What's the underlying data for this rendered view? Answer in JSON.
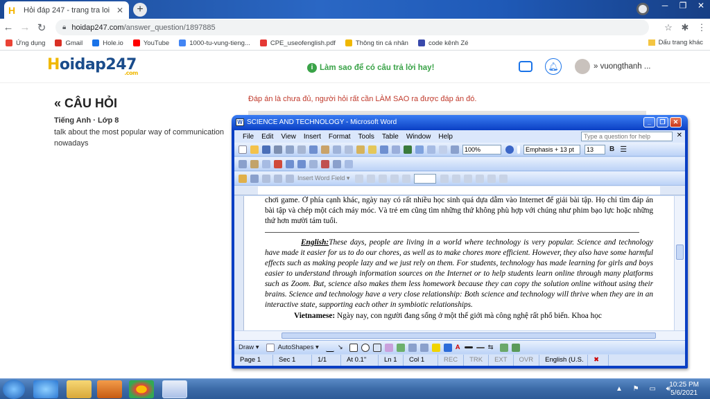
{
  "browser": {
    "tab_title": "Hỏi đáp 247 - trang tra loi",
    "tab_close": "✕",
    "new_tab": "+",
    "url_host": "hoidap247.com",
    "url_path": "/answer_question/1897885",
    "bookmarks": [
      {
        "label": "Ứng dụng",
        "color": "#ea4335"
      },
      {
        "label": "Gmail",
        "color": "#d93025"
      },
      {
        "label": "Hole.io",
        "color": "#1a73e8"
      },
      {
        "label": "YouTube",
        "color": "#ff0000"
      },
      {
        "label": "1000-tu-vung-tieng...",
        "color": "#4285f4"
      },
      {
        "label": "CPE_useofenglish.pdf",
        "color": "#e53935"
      },
      {
        "label": "Thông tin cá nhân",
        "color": "#f0b800"
      },
      {
        "label": "code kênh Zé",
        "color": "#3949ab"
      }
    ],
    "bookmarks_folder": "Dấu trang khác"
  },
  "site": {
    "logo_h": "H",
    "logo_rest": "oidap247",
    "logo_com": ".com",
    "tip": "Làm sao để có câu trả lời hay!",
    "username": "vuongthanh ..."
  },
  "question": {
    "heading": "« CÂU HỎI",
    "subject": "Tiếng Anh · Lớp 8",
    "text": "talk about the most popular way of communication nowadays"
  },
  "answer_note": "Đáp án là chưa đủ, người hỏi rất cần LÀM SAO ra được đáp án đó.",
  "word": {
    "title": "SCIENCE AND TECHNOLOGY - Microsoft Word",
    "menus": [
      "File",
      "Edit",
      "View",
      "Insert",
      "Format",
      "Tools",
      "Table",
      "Window",
      "Help"
    ],
    "ask_placeholder": "Type a question for help",
    "zoom": "100%",
    "style": "Emphasis + 13 pt",
    "font_size": "13",
    "insert_word_field": "Insert Word Field ▾",
    "draw_label": "Draw ▾",
    "autoshapes_label": "AutoShapes ▾",
    "doc": {
      "vn_top": "chơi game. Ở phía cạnh khác, ngày nay có rất nhiều học sinh quá dựa dẫm vào Internet để giải bài tập. Họ chỉ tìm đáp án bài tập và chép một cách máy móc. Và trẻ em cũng tìm những thứ không phù hợp với chúng như phim bạo lực hoặc những thứ hơn mười tám tuổi.",
      "en_label": "English:",
      "en_text": "These days, people are living in a world where technology is very popular. Science and technology have made it easier for us to do our chores, as well as to make chores more efficient. However, they also have some harmful effects such as making people lazy and we just rely on them. For students, technology has made learning for girls and boys easier to understand through information sources on the Internet or to help students learn online through many platforms such as Zoom. But, science also makes them less homework because they can copy the solution online without using their brains. Science and technology have a very close relationship: Both science and technology will thrive when they are in an interactive state, supporting each other in symbiotic relationships.",
      "vn_label": "Vietnamese:",
      "vn_text": "Ngày nay, con người đang sống ở một thế giới mà công nghệ rất phổ biến. Khoa học"
    },
    "status": {
      "page": "Page 1",
      "sec": "Sec 1",
      "pages": "1/1",
      "at": "At 0.1\"",
      "ln": "Ln 1",
      "col": "Col 1",
      "rec": "REC",
      "trk": "TRK",
      "ext": "EXT",
      "ovr": "OVR",
      "lang": "English (U.S."
    }
  },
  "taskbar": {
    "time": "10:25 PM",
    "date": "5/6/2021"
  }
}
